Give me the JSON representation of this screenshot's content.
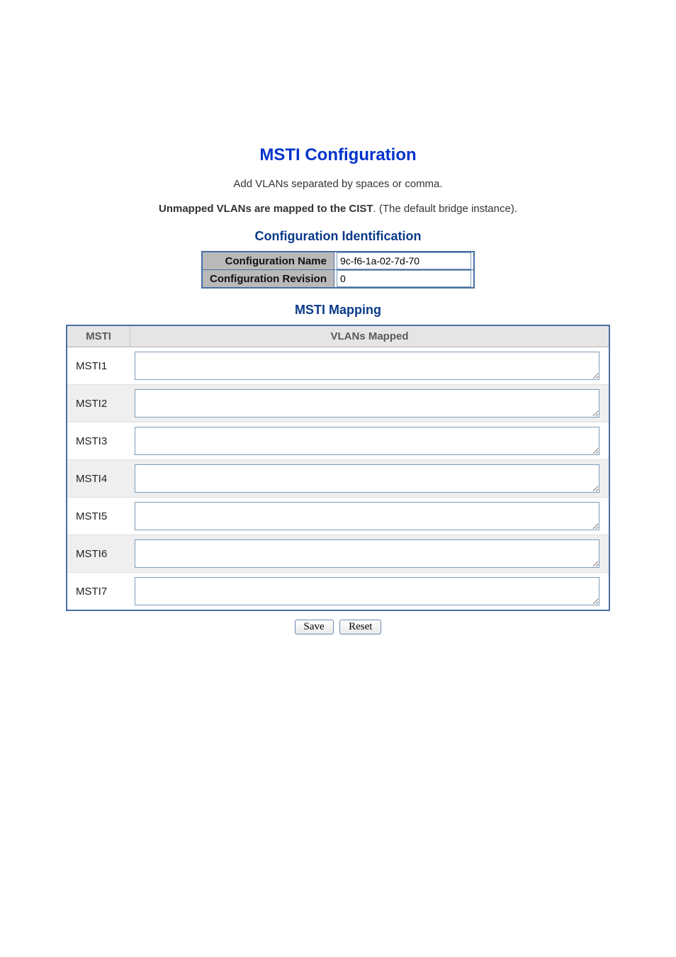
{
  "title": "MSTI Configuration",
  "subtitle1": "Add VLANs separated by spaces or comma.",
  "subtitle2_bold": "Unmapped VLANs are mapped to the CIST",
  "subtitle2_rest": ". (The default bridge instance).",
  "section_config_id": "Configuration Identification",
  "config_id": {
    "name_label": "Configuration Name",
    "name_value": "9c-f6-1a-02-7d-70",
    "rev_label": "Configuration Revision",
    "rev_value": "0"
  },
  "section_mapping": "MSTI Mapping",
  "mapping_headers": {
    "msti": "MSTI",
    "vlans": "VLANs Mapped"
  },
  "mapping": [
    {
      "name": "MSTI1",
      "vlans": ""
    },
    {
      "name": "MSTI2",
      "vlans": ""
    },
    {
      "name": "MSTI3",
      "vlans": ""
    },
    {
      "name": "MSTI4",
      "vlans": ""
    },
    {
      "name": "MSTI5",
      "vlans": ""
    },
    {
      "name": "MSTI6",
      "vlans": ""
    },
    {
      "name": "MSTI7",
      "vlans": ""
    }
  ],
  "buttons": {
    "save": "Save",
    "reset": "Reset"
  }
}
